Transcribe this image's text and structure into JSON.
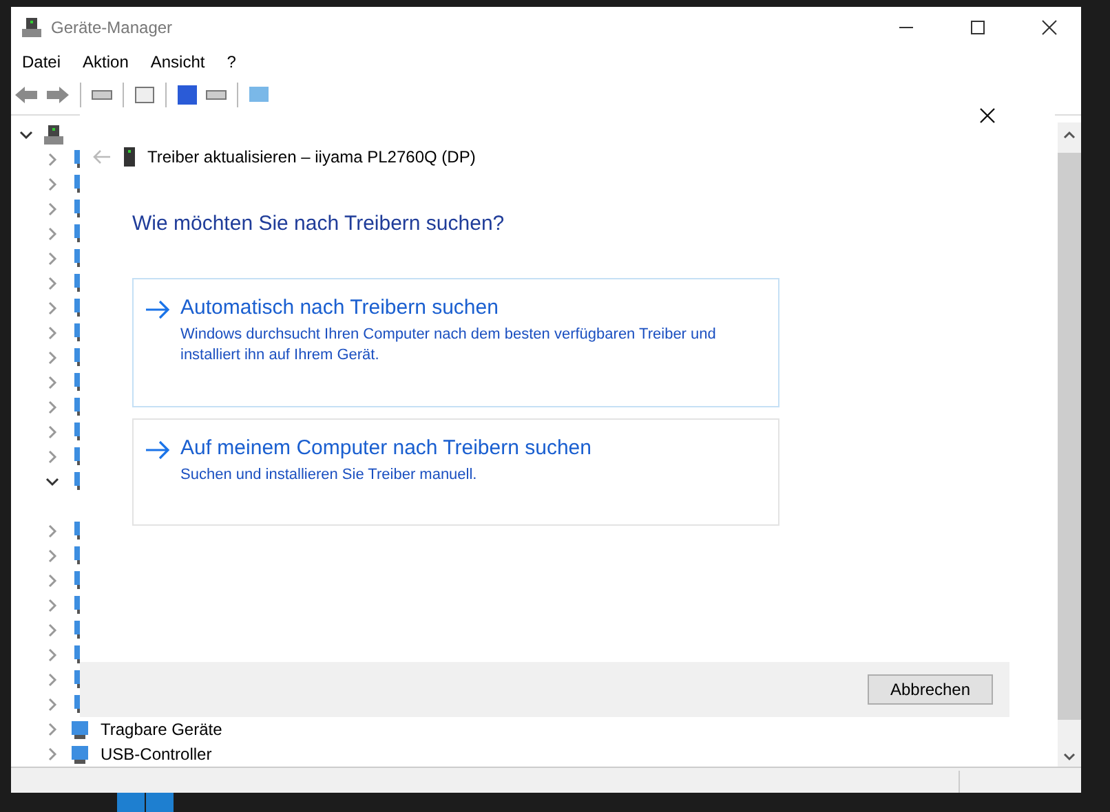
{
  "window": {
    "title": "Geräte-Manager"
  },
  "menu": [
    "Datei",
    "Aktion",
    "Ansicht",
    "?"
  ],
  "tree": {
    "expanded": true,
    "children": [
      {
        "expanded": false
      },
      {
        "expanded": false
      },
      {
        "expanded": false
      },
      {
        "expanded": false
      },
      {
        "expanded": false
      },
      {
        "expanded": false
      },
      {
        "expanded": false
      },
      {
        "expanded": false
      },
      {
        "expanded": false
      },
      {
        "expanded": false
      },
      {
        "expanded": false
      },
      {
        "expanded": false
      },
      {
        "expanded": false
      },
      {
        "expanded": true
      },
      {
        "expanded": false
      },
      {
        "expanded": false
      },
      {
        "expanded": false
      },
      {
        "expanded": false
      },
      {
        "expanded": false
      },
      {
        "expanded": false
      },
      {
        "expanded": false
      },
      {
        "expanded": false
      },
      {
        "label": "Tragbare Geräte",
        "expanded": false
      },
      {
        "label": "USB-Controller",
        "expanded": false
      }
    ]
  },
  "dialog": {
    "title": "Treiber aktualisieren – iiyama PL2760Q (DP)",
    "heading": "Wie möchten Sie nach Treibern suchen?",
    "options": [
      {
        "title": "Automatisch nach Treibern suchen",
        "description": "Windows durchsucht Ihren Computer nach dem besten verfügbaren Treiber und installiert ihn auf Ihrem Gerät.",
        "selected": true
      },
      {
        "title": "Auf meinem Computer nach Treibern suchen",
        "description": "Suchen und installieren Sie Treiber manuell.",
        "selected": false
      }
    ],
    "buttons": [
      "Abbrechen"
    ]
  }
}
